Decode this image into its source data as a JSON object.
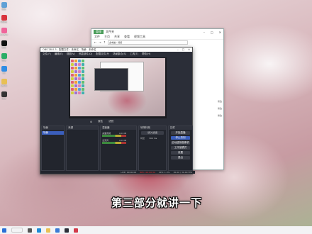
{
  "caption": "第三部分就讲一下",
  "desktop_icons": [
    {
      "label": "网络",
      "color": "#5fa0d6"
    },
    {
      "label": "网易云",
      "color": "#d9323c"
    },
    {
      "label": "BILIBILI",
      "color": "#f0649a"
    },
    {
      "label": "抖音",
      "color": "#111111"
    },
    {
      "label": "微信",
      "color": "#2aae67"
    },
    {
      "label": "QQ",
      "color": "#2f8de4"
    },
    {
      "label": "文件夹",
      "color": "#e8c054"
    },
    {
      "label": "OBS",
      "color": "#333333"
    }
  ],
  "explorer": {
    "manage_label": "管理",
    "title": "文件夹",
    "ribbon": [
      "文件",
      "主页",
      "共享",
      "查看",
      "视频工具"
    ],
    "address": "此电脑 › 视频",
    "right_items": [
      "修改",
      "修改",
      "修改"
    ]
  },
  "obs": {
    "title": "OBS 28.0.3 - 配置文件：未命名 - 场景：未命名",
    "menu": [
      "文件(F)",
      "编辑(E)",
      "视图(V)",
      "停靠部件(D)",
      "配置文件(P)",
      "场景集合(S)",
      "工具(T)",
      "帮助(H)"
    ],
    "status": [
      "属性",
      "滤镜"
    ],
    "docks": {
      "scenes": {
        "header": "场景",
        "item": "场景"
      },
      "sources": {
        "header": "来源"
      },
      "mixer": {
        "header": "混音器",
        "rows": [
          {
            "name": "桌面音频",
            "db": "0.0 dB"
          },
          {
            "name": "麦克风",
            "db": "0.0 dB"
          }
        ]
      },
      "transitions": {
        "header": "转场特效",
        "type": "淡入淡出",
        "duration_label": "时长",
        "duration": "300 ms"
      },
      "controls": {
        "header": "控件",
        "buttons": [
          "开始直播",
          "停止录制",
          "启动虚拟摄像机",
          "工作室模式",
          "设置",
          "退出"
        ]
      }
    },
    "footer": {
      "live": "LIVE: 00:00:00",
      "rec": "REC: 00:00:34",
      "cpu": "CPU: 1.3%",
      "fps": "30.00 / 30.00 FPS"
    }
  },
  "taskbar": {
    "icons": [
      {
        "name": "windows",
        "color": "#2b6fd6"
      },
      {
        "name": "search",
        "color": "#ffffff"
      },
      {
        "name": "task-view",
        "color": "#555555"
      },
      {
        "name": "edge",
        "color": "#1f8bd6"
      },
      {
        "name": "file-explorer",
        "color": "#e8c054"
      },
      {
        "name": "store",
        "color": "#3a7bd5"
      },
      {
        "name": "obs",
        "color": "#2b2e38"
      },
      {
        "name": "video-editor",
        "color": "#d23c4b"
      }
    ]
  }
}
